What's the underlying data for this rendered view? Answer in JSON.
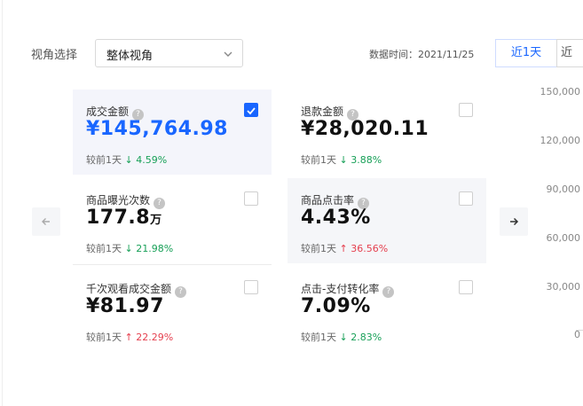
{
  "filter": {
    "view_label": "视角选择",
    "view_selected": "整体视角",
    "data_time": "数据时间：2021/11/25",
    "periods": [
      "近1天",
      "近"
    ]
  },
  "compare_label": "较前1天",
  "metrics": [
    {
      "title": "成交金额",
      "value": "¥145,764.98",
      "unit": "",
      "change": "4.59%",
      "direction": "down",
      "checked": true
    },
    {
      "title": "退款金额",
      "value": "¥28,020.11",
      "unit": "",
      "change": "3.88%",
      "direction": "down",
      "checked": false
    },
    {
      "title": "商品曝光次数",
      "value": "177.8",
      "unit": "万",
      "change": "21.98%",
      "direction": "down",
      "checked": false
    },
    {
      "title": "商品点击率",
      "value": "4.43%",
      "unit": "",
      "change": "36.56%",
      "direction": "up",
      "checked": false
    },
    {
      "title": "千次观看成交金额",
      "value": "¥81.97",
      "unit": "",
      "change": "22.29%",
      "direction": "up",
      "checked": false
    },
    {
      "title": "点击-支付转化率",
      "value": "7.09%",
      "unit": "",
      "change": "2.83%",
      "direction": "down",
      "checked": false
    }
  ],
  "chart_axis": {
    "yticks": [
      "150,000",
      "120,000",
      "90,000",
      "60,000",
      "30,000",
      "0"
    ]
  },
  "colors": {
    "accent": "#1966ff",
    "down": "#18a058",
    "up": "#e5404f"
  },
  "icons": {
    "nav_prev": "arrow-left-icon",
    "nav_next": "arrow-right-icon",
    "help": "question-circle-icon",
    "select": "chevron-down-icon"
  }
}
